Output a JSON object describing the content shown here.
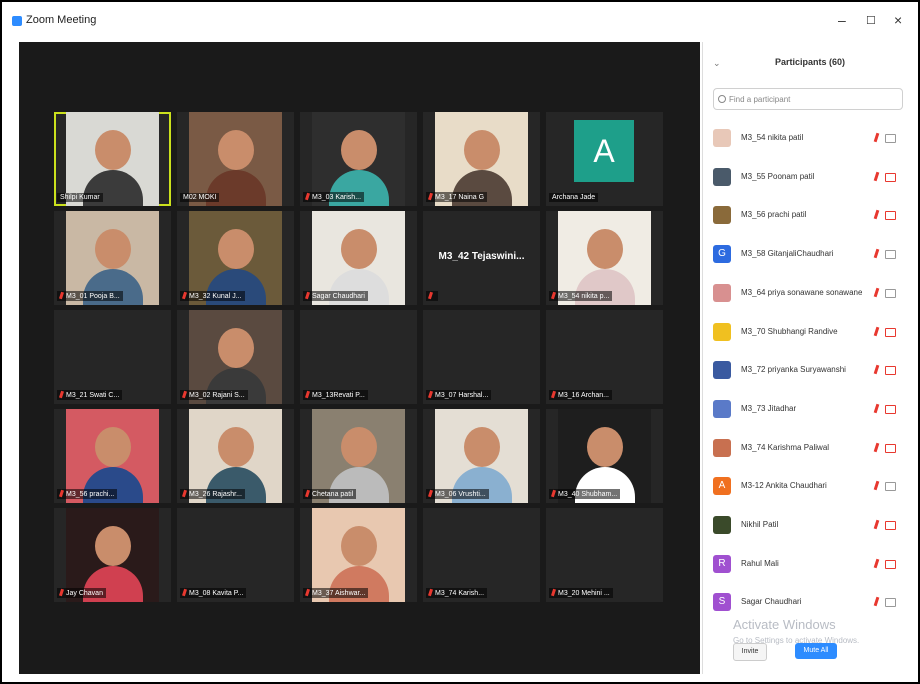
{
  "window": {
    "title": "Zoom Meeting",
    "minimize": "–",
    "maximize": "☐",
    "close": "×"
  },
  "gallery": [
    [
      {
        "name": "Shilpi Kumar",
        "muted": false,
        "active": true,
        "bg": "#d9d9d4",
        "body": "#3b3b3b"
      },
      {
        "name": "M02 MOKI",
        "muted": false,
        "bg": "#7a5a45",
        "body": "#6b3a2a"
      },
      {
        "name": "M3_03 Karish...",
        "muted": true,
        "bg": "#2e2e2e",
        "body": "#3aa7a1"
      },
      {
        "name": "M3_17 Naina G",
        "muted": true,
        "bg": "#e8dcc8",
        "body": "#5a4a40"
      },
      {
        "name": "Archana Jade",
        "muted": false,
        "avatar": "A"
      }
    ],
    [
      {
        "name": "M3_01 Pooja B...",
        "muted": true,
        "bg": "#c9b8a4",
        "body": "#4a6b8a"
      },
      {
        "name": "M3_32 Kunal J...",
        "muted": true,
        "bg": "#6b5a3a",
        "body": "#2a4a7a"
      },
      {
        "name": "Sagar Chaudhari",
        "muted": true,
        "bg": "#e9e6df",
        "body": "#ddd"
      },
      {
        "name": "",
        "muted": true,
        "center_name": "M3_42 Tejaswini..."
      },
      {
        "name": "M3_54 nikita p...",
        "muted": true,
        "bg": "#f0ece4",
        "body": "#e0c8c8"
      }
    ],
    [
      {
        "name": "M3_21 Swati C...",
        "muted": true,
        "empty": true
      },
      {
        "name": "M3_02 Rajani S...",
        "muted": true,
        "bg": "#5a4a40",
        "body": "#3a3a3a"
      },
      {
        "name": "M3_13Revati P...",
        "muted": true,
        "empty": true
      },
      {
        "name": "M3_07 Harshal...",
        "muted": true,
        "empty": true
      },
      {
        "name": "M3_16 Archan...",
        "muted": true,
        "empty": true
      }
    ],
    [
      {
        "name": "M3_56 prachi...",
        "muted": true,
        "bg": "#d45a62",
        "body": "#2a4a8a"
      },
      {
        "name": "M3_26 Rajashr...",
        "muted": true,
        "bg": "#e0d6c8",
        "body": "#3a5a6a"
      },
      {
        "name": "Chetana patil",
        "muted": true,
        "bg": "#8a8070",
        "body": "#bbb"
      },
      {
        "name": "M3_06 Vrushti...",
        "muted": true,
        "bg": "#e4ded4",
        "body": "#8ab0d0"
      },
      {
        "name": "M3_40 Shubham...",
        "muted": true,
        "bg": "#1e1e1e",
        "body": "#fff"
      }
    ],
    [
      {
        "name": "Jay Chavan",
        "muted": true,
        "bg": "#2a1a1a",
        "body": "#d04050"
      },
      {
        "name": "M3_08 Kavita P...",
        "muted": true,
        "empty": true
      },
      {
        "name": "M3_37 Aishwar...",
        "muted": true,
        "bg": "#e8c8b0",
        "body": "#d07a60"
      },
      {
        "name": "M3_74 Karish...",
        "muted": true,
        "empty": true
      },
      {
        "name": "M3_20 Mehini ...",
        "muted": true,
        "empty": true
      }
    ]
  ],
  "participants_panel": {
    "title": "Participants (60)",
    "collapse_icon": "⌄",
    "search_placeholder": "Find a participant",
    "items": [
      {
        "name": "M3_54 nikita patil",
        "avatar_color": "#e8c8b8",
        "letter": "",
        "cam_off": false
      },
      {
        "name": "M3_55 Poonam patil",
        "avatar_color": "#4a5a6a",
        "letter": "",
        "cam_off": true
      },
      {
        "name": "M3_56 prachi patil",
        "avatar_color": "#8a6a3a",
        "letter": "",
        "cam_off": true
      },
      {
        "name": "M3_58 GitanjaliChaudhari",
        "avatar_color": "#2d6be0",
        "letter": "G",
        "cam_off": false
      },
      {
        "name": "M3_64 priya sonawane sonawane",
        "avatar_color": "#d89090",
        "letter": "",
        "cam_off": false
      },
      {
        "name": "M3_70 Shubhangi Randive",
        "avatar_color": "#f0c020",
        "letter": "",
        "cam_off": true
      },
      {
        "name": "M3_72 priyanka Suryawanshi",
        "avatar_color": "#3a5aa0",
        "letter": "",
        "cam_off": true
      },
      {
        "name": "M3_73 Jitadhar",
        "avatar_color": "#5a7ac8",
        "letter": "",
        "cam_off": true
      },
      {
        "name": "M3_74 Karishma Paliwal",
        "avatar_color": "#c87050",
        "letter": "",
        "cam_off": true
      },
      {
        "name": "M3-12 Ankita Chaudhari",
        "avatar_color": "#f07020",
        "letter": "A",
        "cam_off": false
      },
      {
        "name": "Nikhil Patil",
        "avatar_color": "#3a4a2a",
        "letter": "",
        "cam_off": true
      },
      {
        "name": "Rahul Mali",
        "avatar_color": "#a050d0",
        "letter": "R",
        "cam_off": true
      },
      {
        "name": "Sagar Chaudhari",
        "avatar_color": "#a050d0",
        "letter": "S",
        "cam_off": false
      }
    ],
    "watermark": "Activate Windows",
    "watermark_sub": "Go to Settings to activate Windows.",
    "invite_label": "Invite",
    "mute_all_label": "Mute All"
  }
}
